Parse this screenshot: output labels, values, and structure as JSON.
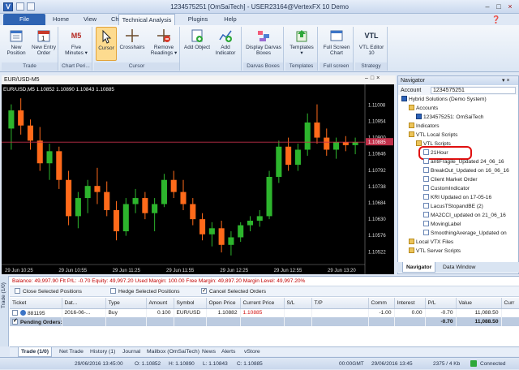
{
  "window": {
    "title": "1234575251 [OmSaiTech] - USER23164@VertexFX 10 Demo",
    "controls": [
      "–",
      "□",
      "×"
    ]
  },
  "tabs": [
    "File",
    "Home",
    "View",
    "Charts",
    "Technical Analysis",
    "Plugins",
    "Help"
  ],
  "ribbon": {
    "groups": {
      "trade": "Trade",
      "chart_period": "Chart Peri...",
      "cursor": "Cursor",
      "darvas": "Darvas Boxes",
      "templates": "Templates",
      "fullscreen": "Full screen",
      "strategy": "Strategy"
    },
    "buttons": {
      "new_position": "New Position",
      "new_entry_order": "New Entry Order",
      "five_minutes": "Five Minutes",
      "cursor": "Cursor",
      "crosshairs": "Crosshairs",
      "remove_readings": "Remove Readings",
      "add_object": "Add Object",
      "add_indicator": "Add Indicator",
      "display_darvas": "Display Darvas Boxes",
      "templates": "Templates",
      "full_screen_chart": "Full Screen Chart",
      "vtl_editor": "VTL Editor 10",
      "m5_badge": "M5",
      "vtl_badge": "VTL"
    }
  },
  "chart": {
    "window_title": "EUR/USD-M5",
    "info": "EUR/USD,M5  1.10852  1.10890  1.10843  1.10885",
    "price_labels": [
      "1.11008",
      "1.10954",
      "1.10900",
      "1.10846",
      "1.10792",
      "1.10738",
      "1.10684",
      "1.10630",
      "1.10576",
      "1.10522"
    ],
    "current_price": "1.10885",
    "time_labels": [
      "29 Jun 10:25",
      "29 Jun 10:55",
      "29 Jun 11:25",
      "29 Jun 11:55",
      "29 Jun 12:25",
      "29 Jun 12:55",
      "29 Jun 13:20"
    ]
  },
  "chart_data": {
    "type": "candlestick",
    "symbol": "EUR/USD",
    "timeframe": "M5",
    "ylim": [
      1.1048,
      1.1106
    ],
    "current_price": 1.10885,
    "candles": [
      {
        "o": 1.1093,
        "h": 1.1101,
        "l": 1.1086,
        "c": 1.1099
      },
      {
        "o": 1.1099,
        "h": 1.1103,
        "l": 1.1091,
        "c": 1.1094
      },
      {
        "o": 1.1094,
        "h": 1.1096,
        "l": 1.1086,
        "c": 1.1089
      },
      {
        "o": 1.1089,
        "h": 1.10935,
        "l": 1.1079,
        "c": 1.10815
      },
      {
        "o": 1.10815,
        "h": 1.1088,
        "l": 1.1076,
        "c": 1.10855
      },
      {
        "o": 1.10855,
        "h": 1.1087,
        "l": 1.1073,
        "c": 1.1076
      },
      {
        "o": 1.1076,
        "h": 1.1079,
        "l": 1.1061,
        "c": 1.1064
      },
      {
        "o": 1.1064,
        "h": 1.1072,
        "l": 1.106,
        "c": 1.107
      },
      {
        "o": 1.107,
        "h": 1.1076,
        "l": 1.1065,
        "c": 1.1074
      },
      {
        "o": 1.1074,
        "h": 1.108,
        "l": 1.1068,
        "c": 1.1072
      },
      {
        "o": 1.1072,
        "h": 1.10755,
        "l": 1.1064,
        "c": 1.1066
      },
      {
        "o": 1.1066,
        "h": 1.1069,
        "l": 1.1056,
        "c": 1.1059
      },
      {
        "o": 1.1059,
        "h": 1.107,
        "l": 1.10575,
        "c": 1.1068
      },
      {
        "o": 1.1068,
        "h": 1.1073,
        "l": 1.1065,
        "c": 1.107
      },
      {
        "o": 1.107,
        "h": 1.1072,
        "l": 1.1063,
        "c": 1.1065
      },
      {
        "o": 1.1065,
        "h": 1.107,
        "l": 1.1059,
        "c": 1.1068
      },
      {
        "o": 1.1068,
        "h": 1.1078,
        "l": 1.1067,
        "c": 1.1076
      },
      {
        "o": 1.1076,
        "h": 1.1079,
        "l": 1.107,
        "c": 1.1072
      },
      {
        "o": 1.1072,
        "h": 1.1076,
        "l": 1.1066,
        "c": 1.1068
      },
      {
        "o": 1.1068,
        "h": 1.107,
        "l": 1.1061,
        "c": 1.1063
      },
      {
        "o": 1.1063,
        "h": 1.1065,
        "l": 1.1056,
        "c": 1.1058
      },
      {
        "o": 1.1058,
        "h": 1.1062,
        "l": 1.1054,
        "c": 1.106
      },
      {
        "o": 1.106,
        "h": 1.10625,
        "l": 1.1052,
        "c": 1.10545
      },
      {
        "o": 1.10545,
        "h": 1.1059,
        "l": 1.1051,
        "c": 1.1057
      },
      {
        "o": 1.1057,
        "h": 1.1062,
        "l": 1.10555,
        "c": 1.1061
      },
      {
        "o": 1.1061,
        "h": 1.1064,
        "l": 1.1059,
        "c": 1.10625
      },
      {
        "o": 1.10625,
        "h": 1.1066,
        "l": 1.10605,
        "c": 1.1064
      },
      {
        "o": 1.1064,
        "h": 1.1079,
        "l": 1.1063,
        "c": 1.1077
      },
      {
        "o": 1.1077,
        "h": 1.1089,
        "l": 1.1075,
        "c": 1.1087
      },
      {
        "o": 1.1087,
        "h": 1.109,
        "l": 1.1079,
        "c": 1.1081
      },
      {
        "o": 1.1081,
        "h": 1.1088,
        "l": 1.1079,
        "c": 1.1086
      },
      {
        "o": 1.1086,
        "h": 1.1098,
        "l": 1.1084,
        "c": 1.1095
      },
      {
        "o": 1.1095,
        "h": 1.1101,
        "l": 1.1088,
        "c": 1.109
      },
      {
        "o": 1.109,
        "h": 1.1093,
        "l": 1.1084,
        "c": 1.1086
      },
      {
        "o": 1.1086,
        "h": 1.109,
        "l": 1.1083,
        "c": 1.10885
      },
      {
        "o": 1.10885,
        "h": 1.10905,
        "l": 1.10855,
        "c": 1.10875
      },
      {
        "o": 1.10875,
        "h": 1.109,
        "l": 1.10845,
        "c": 1.10885
      }
    ]
  },
  "navigator": {
    "title": "Navigator",
    "account_label": "Account",
    "account_value": "1234575251",
    "tree": [
      {
        "label": "Hybrid Solutions (Demo System)",
        "level": 0,
        "icon": "node"
      },
      {
        "label": "Accounts",
        "level": 1,
        "icon": "folder"
      },
      {
        "label": "1234575251: OmSaiTech",
        "level": 2,
        "icon": "node"
      },
      {
        "label": "Indicators",
        "level": 1,
        "icon": "folder"
      },
      {
        "label": "VTL Local Scripts",
        "level": 1,
        "icon": "folder"
      },
      {
        "label": "VTL Scripts",
        "level": 2,
        "icon": "folder"
      },
      {
        "label": "21Hour",
        "level": 3,
        "icon": "doc"
      },
      {
        "label": "antiFragile_Updated 24_06_16",
        "level": 3,
        "icon": "doc"
      },
      {
        "label": "BreakOut_Updated on 16_06_16",
        "level": 3,
        "icon": "doc"
      },
      {
        "label": "Client Market Order",
        "level": 3,
        "icon": "doc"
      },
      {
        "label": "CustomIndicator",
        "level": 3,
        "icon": "doc"
      },
      {
        "label": "KRI Updated on 17-05-16",
        "level": 3,
        "icon": "doc"
      },
      {
        "label": "LacusTStopandBE (2)",
        "level": 3,
        "icon": "doc"
      },
      {
        "label": "MA2CCI_updated on 21_06_16",
        "level": 3,
        "icon": "doc"
      },
      {
        "label": "MovingLabel",
        "level": 3,
        "icon": "doc"
      },
      {
        "label": "SmoothingAverage_Updated on",
        "level": 3,
        "icon": "doc"
      },
      {
        "label": "Local VTX Files",
        "level": 1,
        "icon": "folder"
      },
      {
        "label": "VTL Server Scripts",
        "level": 1,
        "icon": "folder"
      }
    ],
    "tabs": [
      "Navigator",
      "Data Window"
    ]
  },
  "trade": {
    "side_label": "Trade (1/0)",
    "summary": "Balance: 49,997.90  Flt P/L: -0.70  Equity: 49,997.20  Used Margin: 100.00  Free Margin: 49,897.20  Margin Level: 49,997.20%",
    "actions": {
      "close": "Close Selected Positions",
      "hedge": "Hedge Selected Positions",
      "cancel": "Cancel Selected Orders"
    },
    "columns": [
      "Ticket",
      "Dat...",
      "Type",
      "Amount",
      "Symbol",
      "Open Price",
      "Current Price",
      "S/L",
      "T/P",
      "Comm",
      "Interest",
      "P/L",
      "Value",
      "Curr"
    ],
    "rows": [
      {
        "ticket": "881195",
        "date": "2016-06-...",
        "type": "Buy",
        "amount": "0.100",
        "symbol": "EUR/USD",
        "open": "1.10882",
        "current": "1.10885",
        "sl": "",
        "tp": "",
        "comm": "-1.00",
        "interest": "0.00",
        "pl": "-0.70",
        "value": "11,088.50",
        "curr": ""
      }
    ],
    "pending": {
      "label": "Pending Orders:",
      "pl": "-0.70",
      "value": "11,088.50"
    }
  },
  "bottom_tabs": [
    "Trade (1/0)",
    "Net Trade",
    "History (1)",
    "Journal",
    "Mailbox (OmSaiTech)",
    "News",
    "Alerts",
    "vStore"
  ],
  "status": {
    "date": "29/06/2016 13:45:00",
    "o": "O: 1.10852",
    "h": "H: 1.10890",
    "l": "L: 1.10843",
    "c": "C: 1.10885",
    "tz": "00:00GMT",
    "time": "29/06/2016 13:45",
    "kb": "2375 / 4 Kb",
    "conn": "Connected"
  },
  "colors": {
    "bull": "#2db52d",
    "bear": "#ff6a1a",
    "price_line": "#c0304a",
    "highlight_ring": "#e01010",
    "summary_text": "#c00000"
  }
}
